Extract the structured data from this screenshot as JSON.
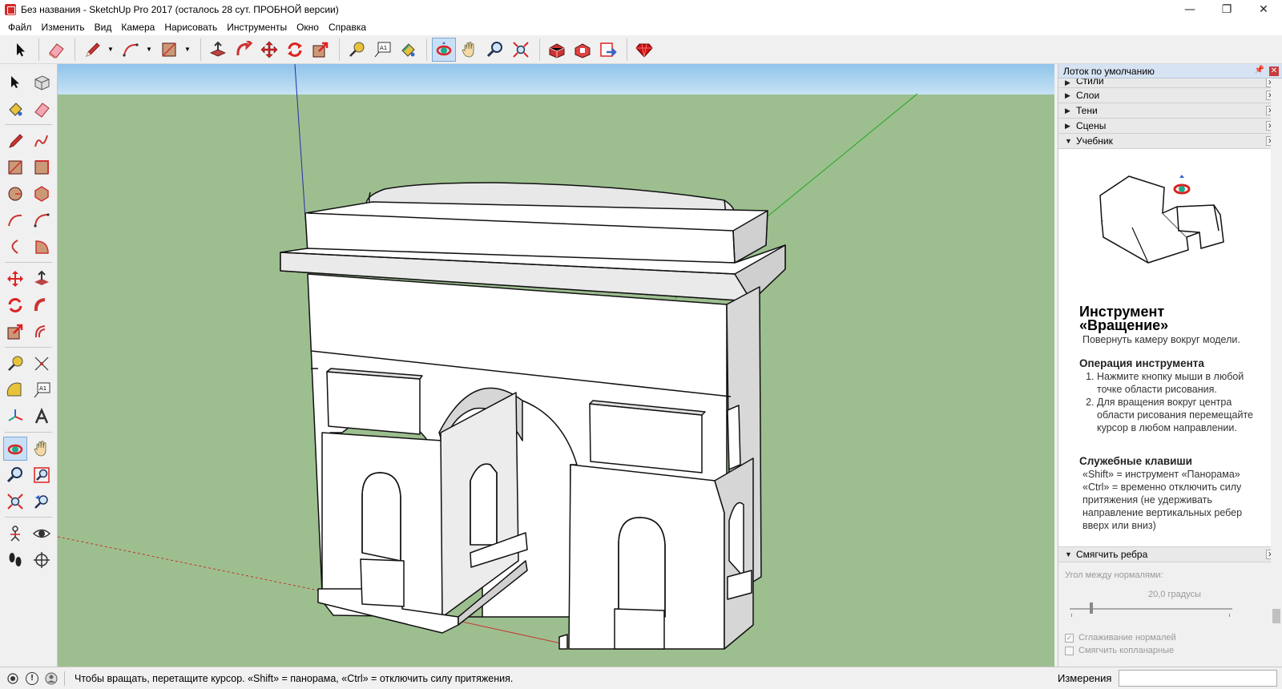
{
  "window": {
    "title": "Без названия - SketchUp Pro 2017 (осталось 28 сут. ПРОБНОЙ версии)",
    "minimize": "—",
    "maximize": "❐",
    "close": "✕"
  },
  "menu": [
    "Файл",
    "Изменить",
    "Вид",
    "Камера",
    "Нарисовать",
    "Инструменты",
    "Окно",
    "Справка"
  ],
  "toolbar": {
    "tools": [
      "select-icon",
      "eraser-icon",
      "pencil-icon",
      "arc-icon",
      "rectangle-icon",
      "push-pull-icon",
      "follow-me-icon",
      "move-icon",
      "rotate-icon",
      "scale-icon",
      "tape-measure-icon",
      "text-icon",
      "paint-bucket-icon",
      "orbit-icon",
      "pan-icon",
      "zoom-icon",
      "zoom-extents-icon",
      "3d-warehouse-icon",
      "extension-warehouse-icon",
      "layout-icon",
      "ruby-icon"
    ],
    "active": "orbit-icon",
    "text_tool_label": "A1"
  },
  "tray": {
    "title": "Лоток по умолчанию",
    "panels": [
      {
        "label": "Стили",
        "expanded": false
      },
      {
        "label": "Слои",
        "expanded": false
      },
      {
        "label": "Тени",
        "expanded": false
      },
      {
        "label": "Сцены",
        "expanded": false
      },
      {
        "label": "Учебник",
        "expanded": true
      }
    ],
    "instructor": {
      "title_line1": "Инструмент",
      "title_line2": "«Вращение»",
      "description": "Повернуть камеру вокруг модели.",
      "operation_heading": "Операция инструмента",
      "steps": [
        "Нажмите кнопку мыши в любой точке области рисования.",
        "Для вращения вокруг центра области рисования перемещайте курсор в любом направлении."
      ],
      "keys_heading": "Служебные клавиши",
      "keys": [
        "«Shift» = инструмент «Панорама»",
        "«Ctrl» = временно отключить силу притяжения (не удерживать направление вертикальных ребер вверх или вниз)"
      ]
    },
    "smooth_panel": {
      "label": "Смягчить ребра",
      "angle_label": "Угол между нормалями:",
      "angle_value": "20,0  градусы",
      "angle_degrees": 20,
      "checkbox_normals": "Сглаживание нормалей",
      "checkbox_normals_checked": true,
      "checkbox_coplanar": "Смягчить копланарные",
      "checkbox_coplanar_checked": false
    }
  },
  "status": {
    "hint": "Чтобы вращать, перетащите курсор. «Shift» = панорама, «Ctrl» = отключить силу притяжения.",
    "measurements_label": "Измерения",
    "measurements_value": ""
  },
  "colors": {
    "sky": "#a9d2ef",
    "ground": "#9dbf8f",
    "model_face": "#ffffff",
    "model_shade": "#c8c8c8",
    "active_tool": "#c9dff5"
  }
}
